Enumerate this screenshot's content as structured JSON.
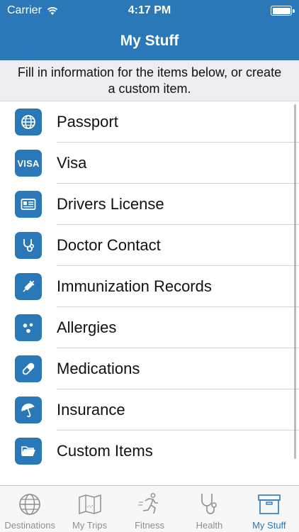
{
  "status_bar": {
    "carrier": "Carrier",
    "time": "4:17 PM"
  },
  "nav": {
    "title": "My Stuff"
  },
  "instructions": "Fill in information for the items below, or create a custom item.",
  "items": [
    {
      "label": "Passport",
      "icon": "globe-icon"
    },
    {
      "label": "Visa",
      "icon": "visa-icon",
      "icon_text": "VISA"
    },
    {
      "label": "Drivers License",
      "icon": "id-card-icon"
    },
    {
      "label": "Doctor Contact",
      "icon": "stethoscope-icon"
    },
    {
      "label": "Immunization Records",
      "icon": "syringe-icon"
    },
    {
      "label": "Allergies",
      "icon": "pollen-icon"
    },
    {
      "label": "Medications",
      "icon": "pill-icon"
    },
    {
      "label": "Insurance",
      "icon": "umbrella-icon"
    },
    {
      "label": "Custom Items",
      "icon": "folder-icon"
    }
  ],
  "tabs": [
    {
      "label": "Destinations",
      "icon": "globe-icon",
      "active": false
    },
    {
      "label": "My Trips",
      "icon": "map-icon",
      "active": false
    },
    {
      "label": "Fitness",
      "icon": "runner-icon",
      "active": false
    },
    {
      "label": "Health",
      "icon": "stethoscope-icon",
      "active": false
    },
    {
      "label": "My Stuff",
      "icon": "archive-box-icon",
      "active": true
    }
  ],
  "colors": {
    "accent": "#2a78b8",
    "tab_inactive": "#8e8e93",
    "banner_bg": "#ededf2"
  }
}
